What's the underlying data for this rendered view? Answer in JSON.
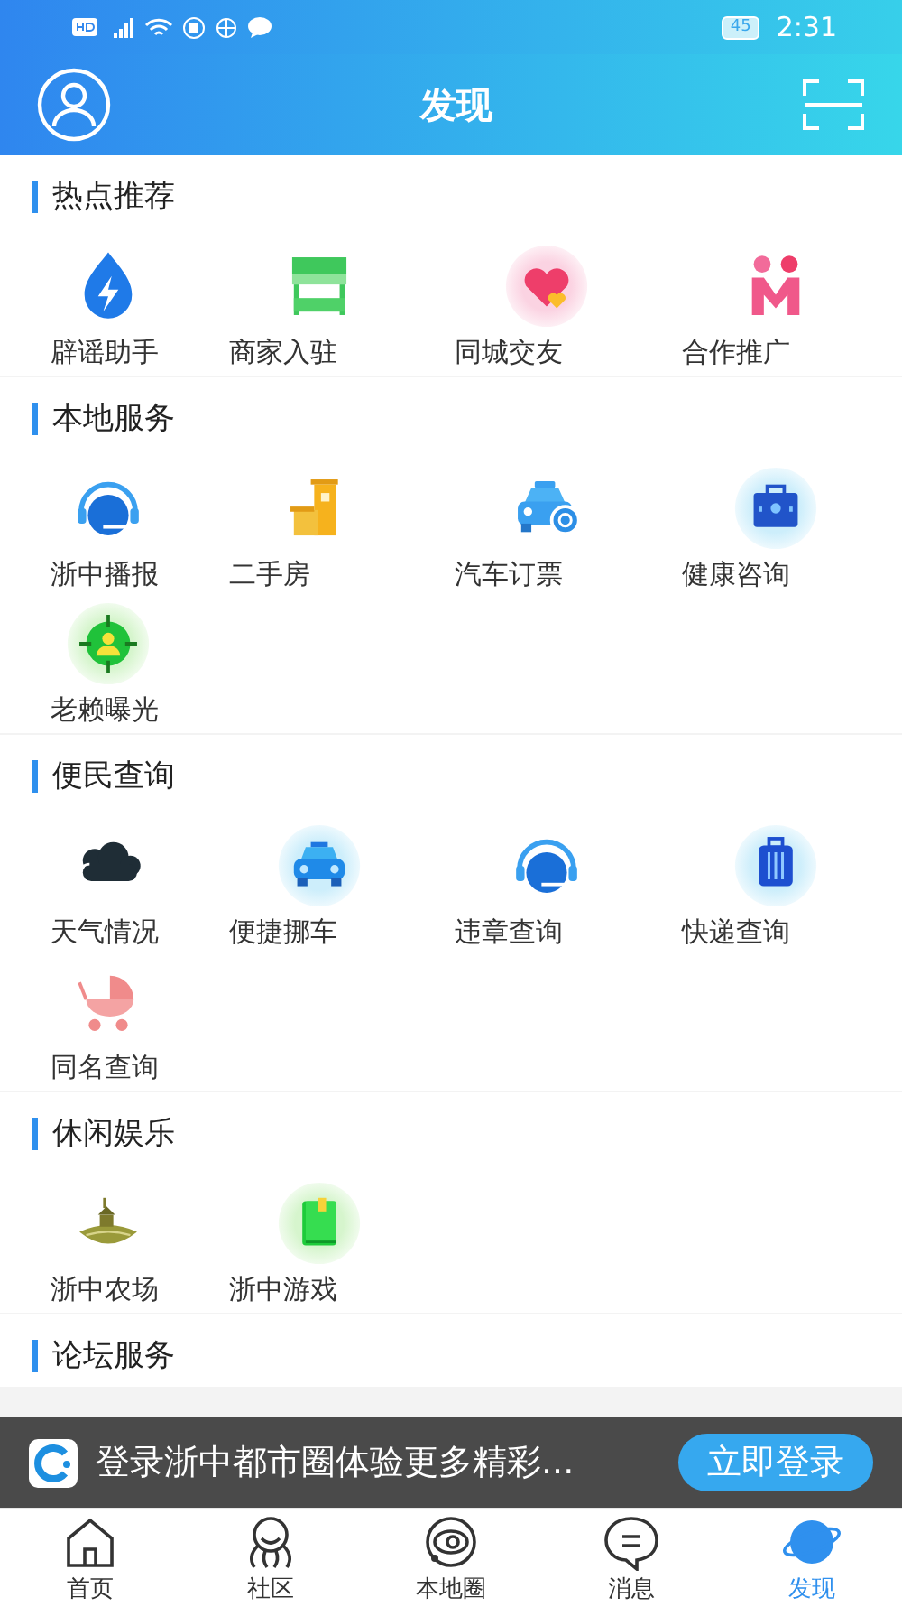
{
  "status_bar": {
    "battery": "45",
    "time": "2:31"
  },
  "header": {
    "title": "发现"
  },
  "sections": [
    {
      "title": "热点推荐",
      "items": [
        {
          "label": "辟谣助手"
        },
        {
          "label": "商家入驻"
        },
        {
          "label": "同城交友"
        },
        {
          "label": "合作推广"
        }
      ]
    },
    {
      "title": "本地服务",
      "items": [
        {
          "label": "浙中播报"
        },
        {
          "label": "二手房"
        },
        {
          "label": "汽车订票"
        },
        {
          "label": "健康咨询"
        },
        {
          "label": "老赖曝光"
        }
      ]
    },
    {
      "title": "便民查询",
      "items": [
        {
          "label": "天气情况"
        },
        {
          "label": "便捷挪车"
        },
        {
          "label": "违章查询"
        },
        {
          "label": "快递查询"
        },
        {
          "label": "同名查询"
        }
      ]
    },
    {
      "title": "休闲娱乐",
      "items": [
        {
          "label": "浙中农场"
        },
        {
          "label": "浙中游戏"
        }
      ]
    },
    {
      "title": "论坛服务"
    }
  ],
  "banner": {
    "text": "登录浙中都市圈体验更多精彩...",
    "button": "立即登录"
  },
  "tabs": [
    {
      "label": "首页",
      "selected": false
    },
    {
      "label": "社区",
      "selected": false
    },
    {
      "label": "本地圈",
      "selected": false
    },
    {
      "label": "消息",
      "selected": false
    },
    {
      "label": "发现",
      "selected": true
    }
  ]
}
